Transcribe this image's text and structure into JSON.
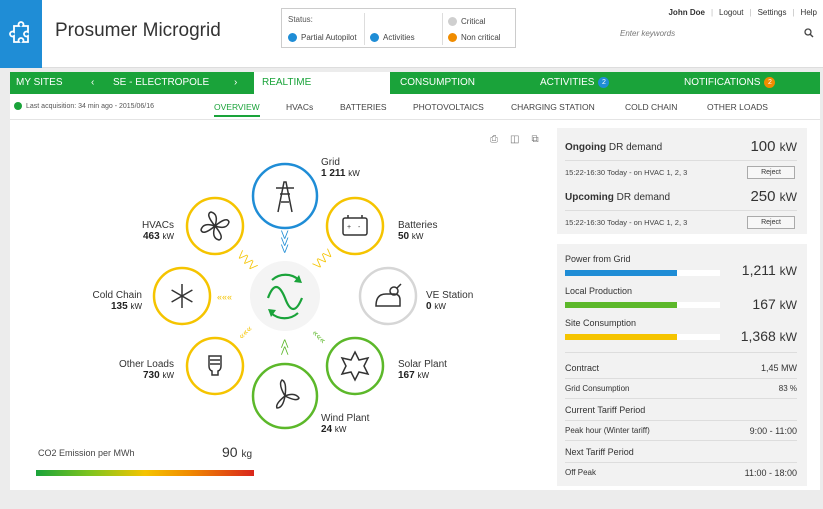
{
  "app": {
    "title": "Prosumer Microgrid"
  },
  "status": {
    "label": "Status:",
    "items": [
      {
        "label": "Partial Autopilot",
        "color": "#1f8dd6",
        "icon": "autopilot-icon"
      },
      {
        "label": "Activities",
        "color": "#1f8dd6",
        "icon": "activities-icon"
      },
      {
        "label": "Critical",
        "color": "#cfcfcf",
        "icon": "critical-icon"
      },
      {
        "label": "Non critical",
        "color": "#f08c00",
        "icon": "non-critical-icon"
      }
    ]
  },
  "user": {
    "name": "John Doe",
    "links": [
      "Logout",
      "Settings",
      "Help"
    ]
  },
  "search": {
    "placeholder": "Enter keywords"
  },
  "nav": {
    "my_sites": "MY SITES",
    "site": "SE - ELECTROPOLE",
    "realtime": "REALTIME",
    "consumption": "CONSUMPTION",
    "activities": "ACTIVITIES",
    "activities_count": "2",
    "notifications": "NOTIFICATIONS",
    "notifications_count": "2"
  },
  "subnav": {
    "last_acquisition": "Last acquisition: 34 min ago - 2015/06/16",
    "tabs": [
      "OVERVIEW",
      "HVACs",
      "BATTERIES",
      "PHOTOVOLTAICS",
      "CHARGING STATION",
      "COLD CHAIN",
      "OTHER LOADS"
    ]
  },
  "nodes": {
    "grid": {
      "name": "Grid",
      "value": "1 211",
      "unit": "kW"
    },
    "batteries": {
      "name": "Batteries",
      "value": "50",
      "unit": "kW"
    },
    "ve_station": {
      "name": "VE Station",
      "value": "0",
      "unit": "kW"
    },
    "solar": {
      "name": "Solar Plant",
      "value": "167",
      "unit": "kW"
    },
    "wind": {
      "name": "Wind Plant",
      "value": "24",
      "unit": "kW"
    },
    "other": {
      "name": "Other Loads",
      "value": "730",
      "unit": "kW"
    },
    "cold": {
      "name": "Cold Chain",
      "value": "135",
      "unit": "kW"
    },
    "hvac": {
      "name": "HVACs",
      "value": "463",
      "unit": "kW"
    }
  },
  "co2": {
    "label": "CO2 Emission per MWh",
    "value": "90",
    "unit": "kg"
  },
  "dr": {
    "ongoing_label": "Ongoing",
    "ongoing_rest": " DR demand",
    "ongoing_value": "100",
    "ongoing_detail": "15:22-16:30 Today - on HVAC 1, 2, 3",
    "upcoming_label": "Upcoming",
    "upcoming_rest": " DR demand",
    "upcoming_value": "250",
    "upcoming_detail": "15:22-16:30 Today - on HVAC 1, 2, 3",
    "unit": "kW",
    "reject": "Reject"
  },
  "power": {
    "items": [
      {
        "label": "Power from Grid",
        "value": "1,211",
        "unit": "kW",
        "fill": 0.72,
        "color": "#1f8dd6"
      },
      {
        "label": "Local Production",
        "value": "167",
        "unit": "kW",
        "fill": 0.72,
        "color": "#5cb82a"
      },
      {
        "label": "Site Consumption",
        "value": "1,368",
        "unit": "kW",
        "fill": 0.72,
        "color": "#f5c400"
      }
    ],
    "contract_label": "Contract",
    "contract_value": "1,45 MW",
    "grid_consumption_label": "Grid Consumption",
    "grid_consumption_value": "83 %",
    "current_tariff_label": "Current Tariff Period",
    "current_tariff_name": "Peak hour (Winter tariff)",
    "current_tariff_time": "9:00 - 11:00",
    "next_tariff_label": "Next Tariff Period",
    "next_tariff_name": "Off Peak",
    "next_tariff_time": "11:00 - 18:00"
  },
  "colors": {
    "green": "#1aa33a",
    "blue": "#1f8dd6",
    "yellow": "#f5c400",
    "grey": "#d6d6d6"
  }
}
